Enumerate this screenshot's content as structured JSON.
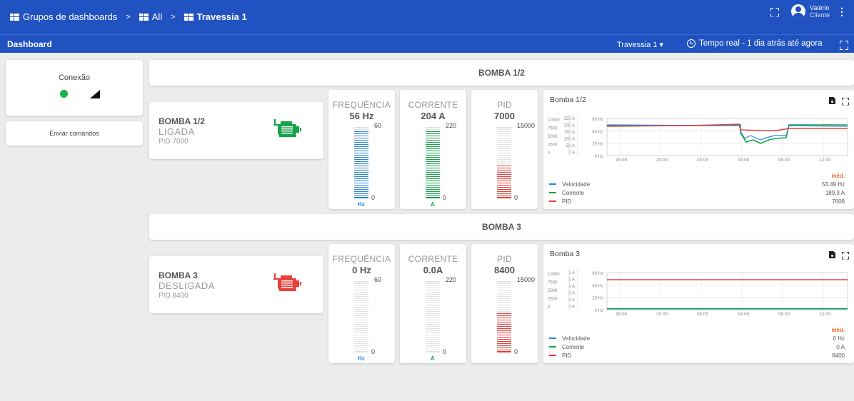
{
  "header": {
    "crumbs": [
      "Grupos de dashboards",
      "All",
      "Travessia 1"
    ],
    "user_name": "Valério",
    "user_role": "Cliente"
  },
  "subbar": {
    "title": "Dashboard",
    "selector": "Travessia 1 ▾",
    "time_range": "Tempo real - 1 dia atrás até agora"
  },
  "sidebar": {
    "connection_title": "Conexão",
    "command_button": "Enviar comandos"
  },
  "colors": {
    "blue": "#2152c1",
    "green": "#17a34a",
    "red": "#e8403a",
    "gauge_blue": "#2b87d8",
    "avg": "#f26a2a"
  },
  "pumps": [
    {
      "section": "BOMBA 1/2",
      "name": "BOMBA 1/2",
      "state": "LIGADA",
      "pid_text": "PID 7000",
      "motor_color": "#17a34a",
      "gauges": [
        {
          "label": "FREQUÊNCIA",
          "value": "56 Hz",
          "max": "60",
          "min": "0",
          "unit": "Hz",
          "level": 0.93,
          "color": "#2b87d8"
        },
        {
          "label": "CORRENTE",
          "value": "204 A",
          "max": "220",
          "min": "0",
          "unit": "A",
          "level": 0.93,
          "color": "#17a34a"
        },
        {
          "label": "PID",
          "value": "7000",
          "max": "15000",
          "min": "0",
          "unit": "",
          "level": 0.47,
          "color": "#e8403a"
        }
      ],
      "chart": {
        "title": "Bomba 1/2",
        "legend_header": "méd.",
        "series": [
          {
            "name": "Velocidade",
            "avg": "53.49 Hz",
            "color": "#2b87d8"
          },
          {
            "name": "Corrente",
            "avg": "189.3 A",
            "color": "#17a34a"
          },
          {
            "name": "PID",
            "avg": "7606",
            "color": "#e8403a"
          }
        ]
      }
    },
    {
      "section": "BOMBA 3",
      "name": "BOMBA 3",
      "state": "DESLIGADA",
      "pid_text": "PID 8400",
      "motor_color": "#e8403a",
      "gauges": [
        {
          "label": "FREQUÊNCIA",
          "value": "0 Hz",
          "max": "60",
          "min": "0",
          "unit": "Hz",
          "level": 0,
          "color": "#2b87d8"
        },
        {
          "label": "CORRENTE",
          "value": "0.0A",
          "max": "220",
          "min": "0",
          "unit": "A",
          "level": 0,
          "color": "#17a34a"
        },
        {
          "label": "PID",
          "value": "8400",
          "max": "15000",
          "min": "0",
          "unit": "",
          "level": 0.56,
          "color": "#e8403a"
        }
      ],
      "chart": {
        "title": "Bomba 3",
        "legend_header": "méd.",
        "series": [
          {
            "name": "Velocidade",
            "avg": "0 Hz",
            "color": "#2b87d8"
          },
          {
            "name": "Corrente",
            "avg": "0 A",
            "color": "#17a34a"
          },
          {
            "name": "PID",
            "avg": "8400",
            "color": "#e8403a"
          }
        ]
      }
    }
  ],
  "chart_axes": {
    "x_ticks": [
      "16:00",
      "20:00",
      "00:00",
      "04:00",
      "08:00",
      "12:00"
    ],
    "pid_ticks": [
      "10000",
      "7500",
      "5000",
      "2500",
      "0"
    ],
    "current_ticks_1": [
      "250 A",
      "200 A",
      "150 A",
      "100 A",
      "50 A",
      "0 A"
    ],
    "current_ticks_3": [
      "1 A",
      "1 A",
      "1 A",
      "0 A",
      "0 A",
      "0 A"
    ],
    "freq_ticks": [
      "60 Hz",
      "40 Hz",
      "20 Hz",
      "0 Hz"
    ]
  }
}
